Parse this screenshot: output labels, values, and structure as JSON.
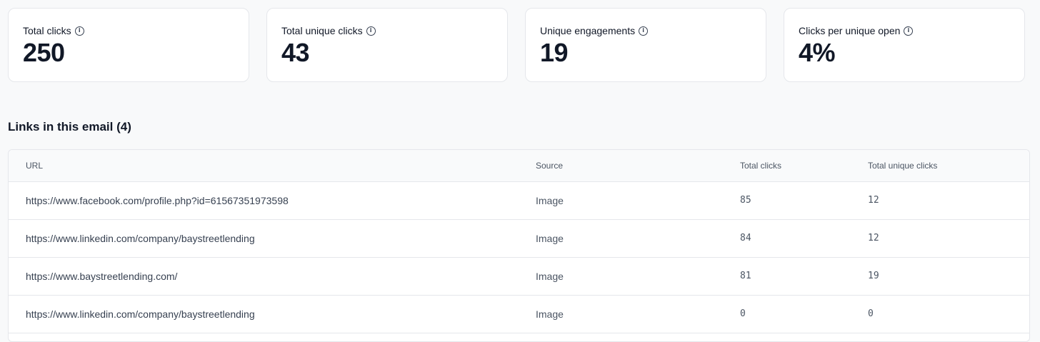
{
  "stats": [
    {
      "label": "Total clicks",
      "value": "250"
    },
    {
      "label": "Total unique clicks",
      "value": "43"
    },
    {
      "label": "Unique engagements",
      "value": "19"
    },
    {
      "label": "Clicks per unique open",
      "value": "4%"
    }
  ],
  "info_icon": "info-icon",
  "links_section": {
    "title": "Links in this email (4)",
    "columns": [
      "URL",
      "Source",
      "Total clicks",
      "Total unique clicks"
    ],
    "rows": [
      {
        "url": "https://www.facebook.com/profile.php?id=61567351973598",
        "source": "Image",
        "total_clicks": "85",
        "unique_clicks": "12"
      },
      {
        "url": "https://www.linkedin.com/company/baystreetlending",
        "source": "Image",
        "total_clicks": "84",
        "unique_clicks": "12"
      },
      {
        "url": "https://www.baystreetlending.com/",
        "source": "Image",
        "total_clicks": "81",
        "unique_clicks": "19"
      },
      {
        "url": "https://www.linkedin.com/company/baystreetlending",
        "source": "Image",
        "total_clicks": "0",
        "unique_clicks": "0"
      }
    ]
  }
}
